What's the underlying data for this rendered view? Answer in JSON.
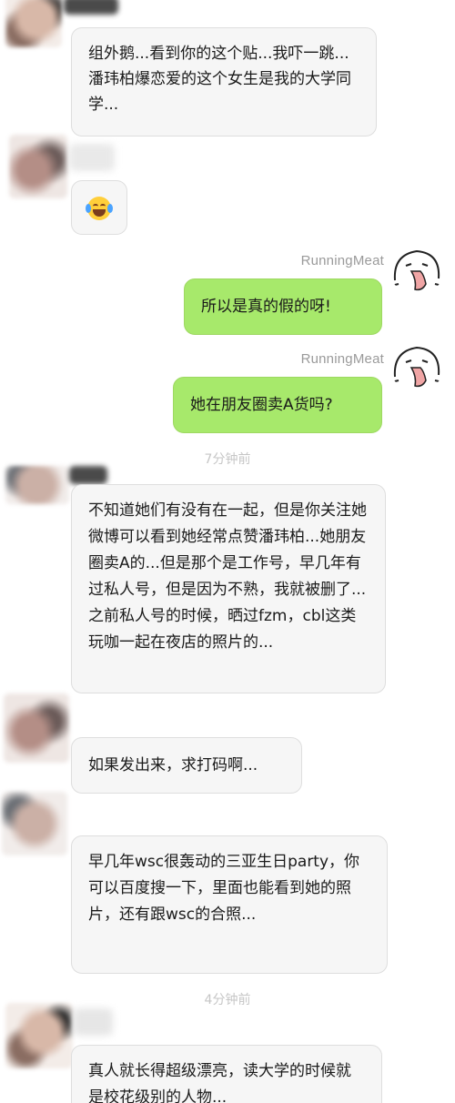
{
  "messages": [
    {
      "side": "left",
      "text": "组外鹅...看到你的这个贴...我吓一跳...潘玮柏爆恋爱的这个女生是我的大学同学..."
    },
    {
      "side": "left",
      "emoji": "face-with-tears-of-joy-icon"
    },
    {
      "side": "right",
      "sender": "RunningMeat",
      "text": "所以是真的假的呀!"
    },
    {
      "side": "right",
      "sender": "RunningMeat",
      "text": "她在朋友圈卖A货吗?"
    },
    {
      "timestamp": "7分钟前"
    },
    {
      "side": "left",
      "text": "不知道她们有没有在一起，但是你关注她微博可以看到她经常点赞潘玮柏...她朋友圈卖A的...但是那个是工作号，早几年有过私人号，但是因为不熟，我就被删了...之前私人号的时候，晒过fzm，cbl这类玩咖一起在夜店的照片的..."
    },
    {
      "side": "left",
      "text": "如果发出来，求打码啊..."
    },
    {
      "side": "left",
      "text": "早几年wsc很轰动的三亚生日party，你可以百度搜一下，里面也能看到她的照片，还有跟wsc的合照..."
    },
    {
      "timestamp": "4分钟前"
    },
    {
      "side": "left",
      "text": "真人就长得超级漂亮，读大学的时候就是校花级别的人物..."
    }
  ],
  "colors": {
    "left_bubble": "#f6f6f6",
    "right_bubble": "#a7e96b",
    "timestamp_text": "#c6c6c6",
    "sender_name": "#9a9a9a"
  }
}
